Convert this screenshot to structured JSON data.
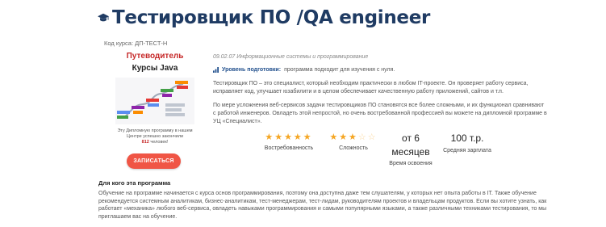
{
  "header": {
    "icon": "graduation-cap-icon",
    "title": "Тестировщик ПО /QA engineer",
    "course_code": "Код курса: ДП-ТЕСТ-Н"
  },
  "guide": {
    "title": "Путеводитель",
    "subtitle": "Курсы Java",
    "note_before": "Эту Дипломную программу в нашем Центре успешно закончили",
    "note_count": "812",
    "note_after": "человек!"
  },
  "signup": {
    "label": "ЗАПИСАТЬСЯ"
  },
  "course": {
    "specialty": "09.02.07 Информационные системы и программирование",
    "level_icon": "bar-chart-icon",
    "level_label": "Уровень подготовки:",
    "level_value": "программа подходит для изучения с нуля.",
    "description_1": "Тестировщик ПО – это специалист, который необходим практически в любом IT-проекте. Он проверяет работу сервиса, исправляет код, улучшает юзабилити и в целом обеспечивает качественную работу приложений, сайтов и т.п.",
    "description_2": "По мере усложнения веб-сервисов задачи тестировщиков ПО становятся все более сложными, и их функционал сравнивают с работой инженеров. Овладеть этой непростой, но очень востребованной профессией вы можете на дипломной программе в УЦ «Специалист»."
  },
  "metrics": {
    "demand": {
      "rating": 5,
      "max": 5,
      "stars": "★★★★★",
      "stars_off": "",
      "label": "Востребованность"
    },
    "difficulty": {
      "rating": 3,
      "max": 5,
      "stars": "★★★",
      "stars_off": "☆☆",
      "label": "Сложность"
    },
    "duration": {
      "value_line1": "от 6",
      "value_line2": "месяцев",
      "label": "Время освоения"
    },
    "salary": {
      "value": "100 т.р.",
      "label": "Средняя зарплата"
    }
  },
  "for_whom": {
    "title": "Для кого эта программа",
    "text": "Обучение на программе начинается с курса основ программирования, поэтому она доступна даже тем слушателям, у которых нет опыта работы в IT. Также обучение рекомендуется системным аналитикам, бизнес-аналитикам, тест-менеджерам, тест-лидам, руководителям проектов и владельцам продуктов. Если вы хотите узнать, как работает «механика» любого веб-сервиса, овладеть навыками программирования и самыми популярными языками, а также различными техниками тестирования, то мы приглашаем вас на обучение."
  },
  "colors": {
    "title": "#1f3b63",
    "accent_red": "#c62828",
    "button": "#f05545",
    "star": "#f5a623",
    "link_blue": "#1f4e8c"
  }
}
